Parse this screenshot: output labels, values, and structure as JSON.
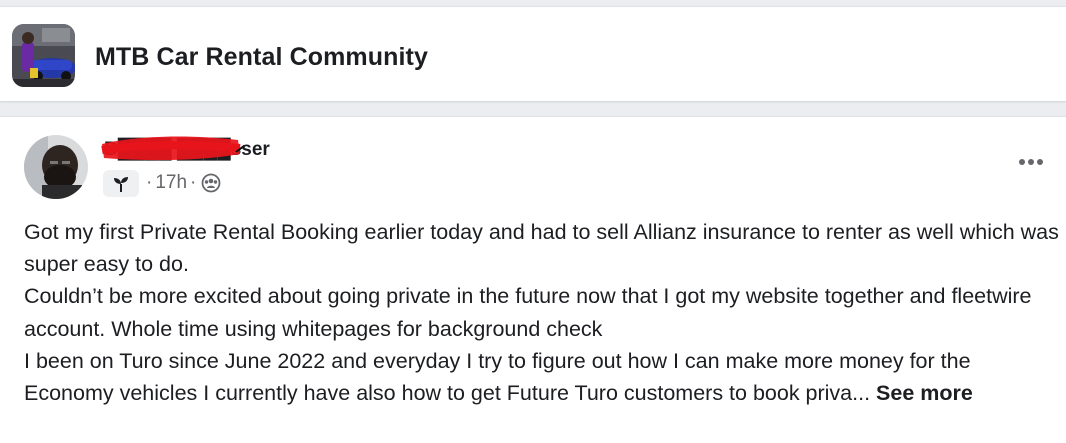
{
  "group": {
    "name": "MTB Car Rental Community",
    "avatar_icon": "group-photo-purple-car"
  },
  "post": {
    "author_name": "B████ ████sser",
    "timestamp": "17h",
    "meta_separator": "·",
    "audience_icon": "group-members-icon",
    "badge_icon": "new-member-sprout-icon",
    "more_icon": "more-options-icon",
    "body": [
      "Got my first Private Rental Booking earlier today and had to sell Allianz insurance to renter as well which was super easy to do.",
      "Couldn’t be more excited about going private in the future now that I got my website together and fleetwire account. Whole time using whitepages for background check",
      "I been on Turo since June 2022 and everyday I try to figure out how I can make more money for the Economy vehicles I currently have also how to get Future Turo customers to book priva..."
    ],
    "see_more_label": "See more"
  },
  "colors": {
    "text_primary": "#1c1e21",
    "text_secondary": "#65676b",
    "background": "#ebedf0",
    "card": "#ffffff",
    "redaction": "#e8141b"
  }
}
